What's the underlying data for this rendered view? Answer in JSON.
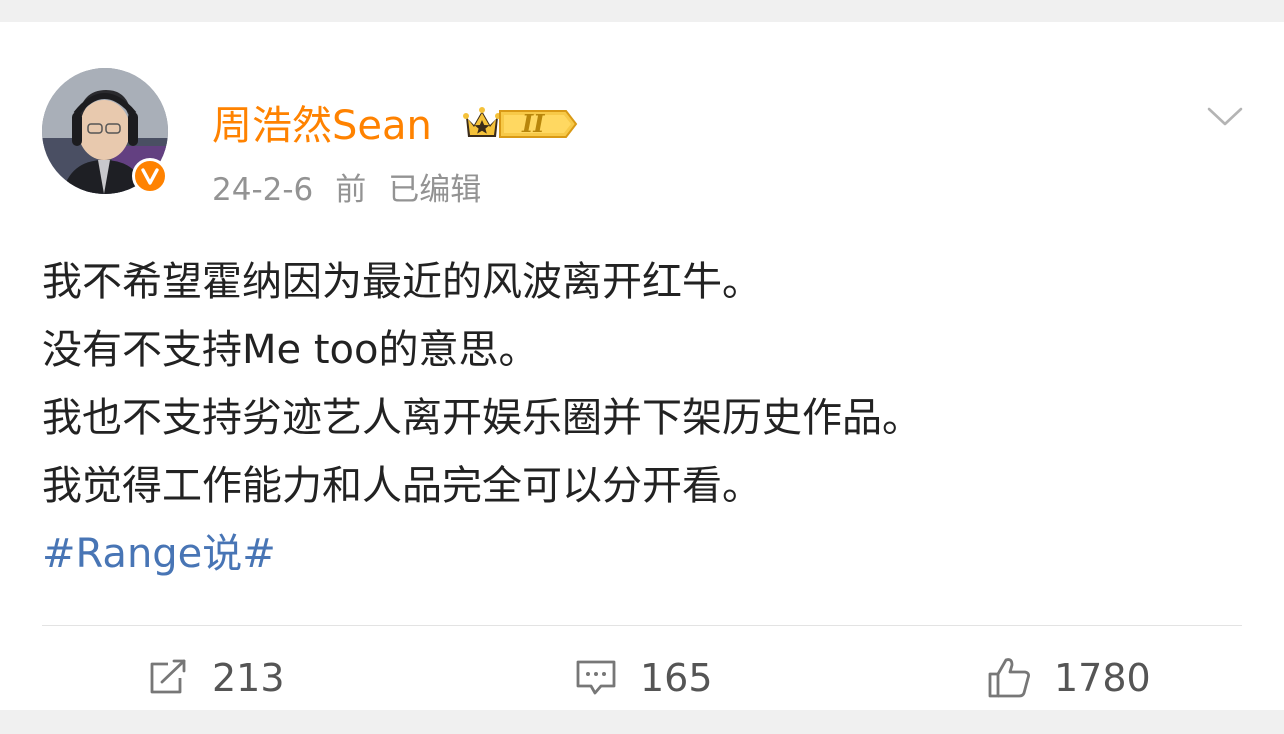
{
  "post": {
    "author": {
      "name": "周浩然Sean",
      "badge_level": "II",
      "verified_icon": "verified-v-badge",
      "verified_color": "#ff8200"
    },
    "meta": {
      "date": "24-2-6",
      "suffix": "前",
      "edited": "已编辑"
    },
    "content": {
      "lines": [
        "我不希望霍纳因为最近的风波离开红牛。",
        "没有不支持Me too的意思。",
        "我也不支持劣迹艺人离开娱乐圈并下架历史作品。",
        "我觉得工作能力和人品完全可以分开看。"
      ],
      "hashtag": "#Range说#"
    },
    "actions": {
      "repost": {
        "icon": "share-icon",
        "count": "213"
      },
      "comment": {
        "icon": "comment-icon",
        "count": "165"
      },
      "like": {
        "icon": "thumbs-up-icon",
        "count": "1780"
      }
    }
  },
  "colors": {
    "name": "#ff8200",
    "hashtag": "#4875b5",
    "meta": "#939393",
    "text": "#222222"
  }
}
